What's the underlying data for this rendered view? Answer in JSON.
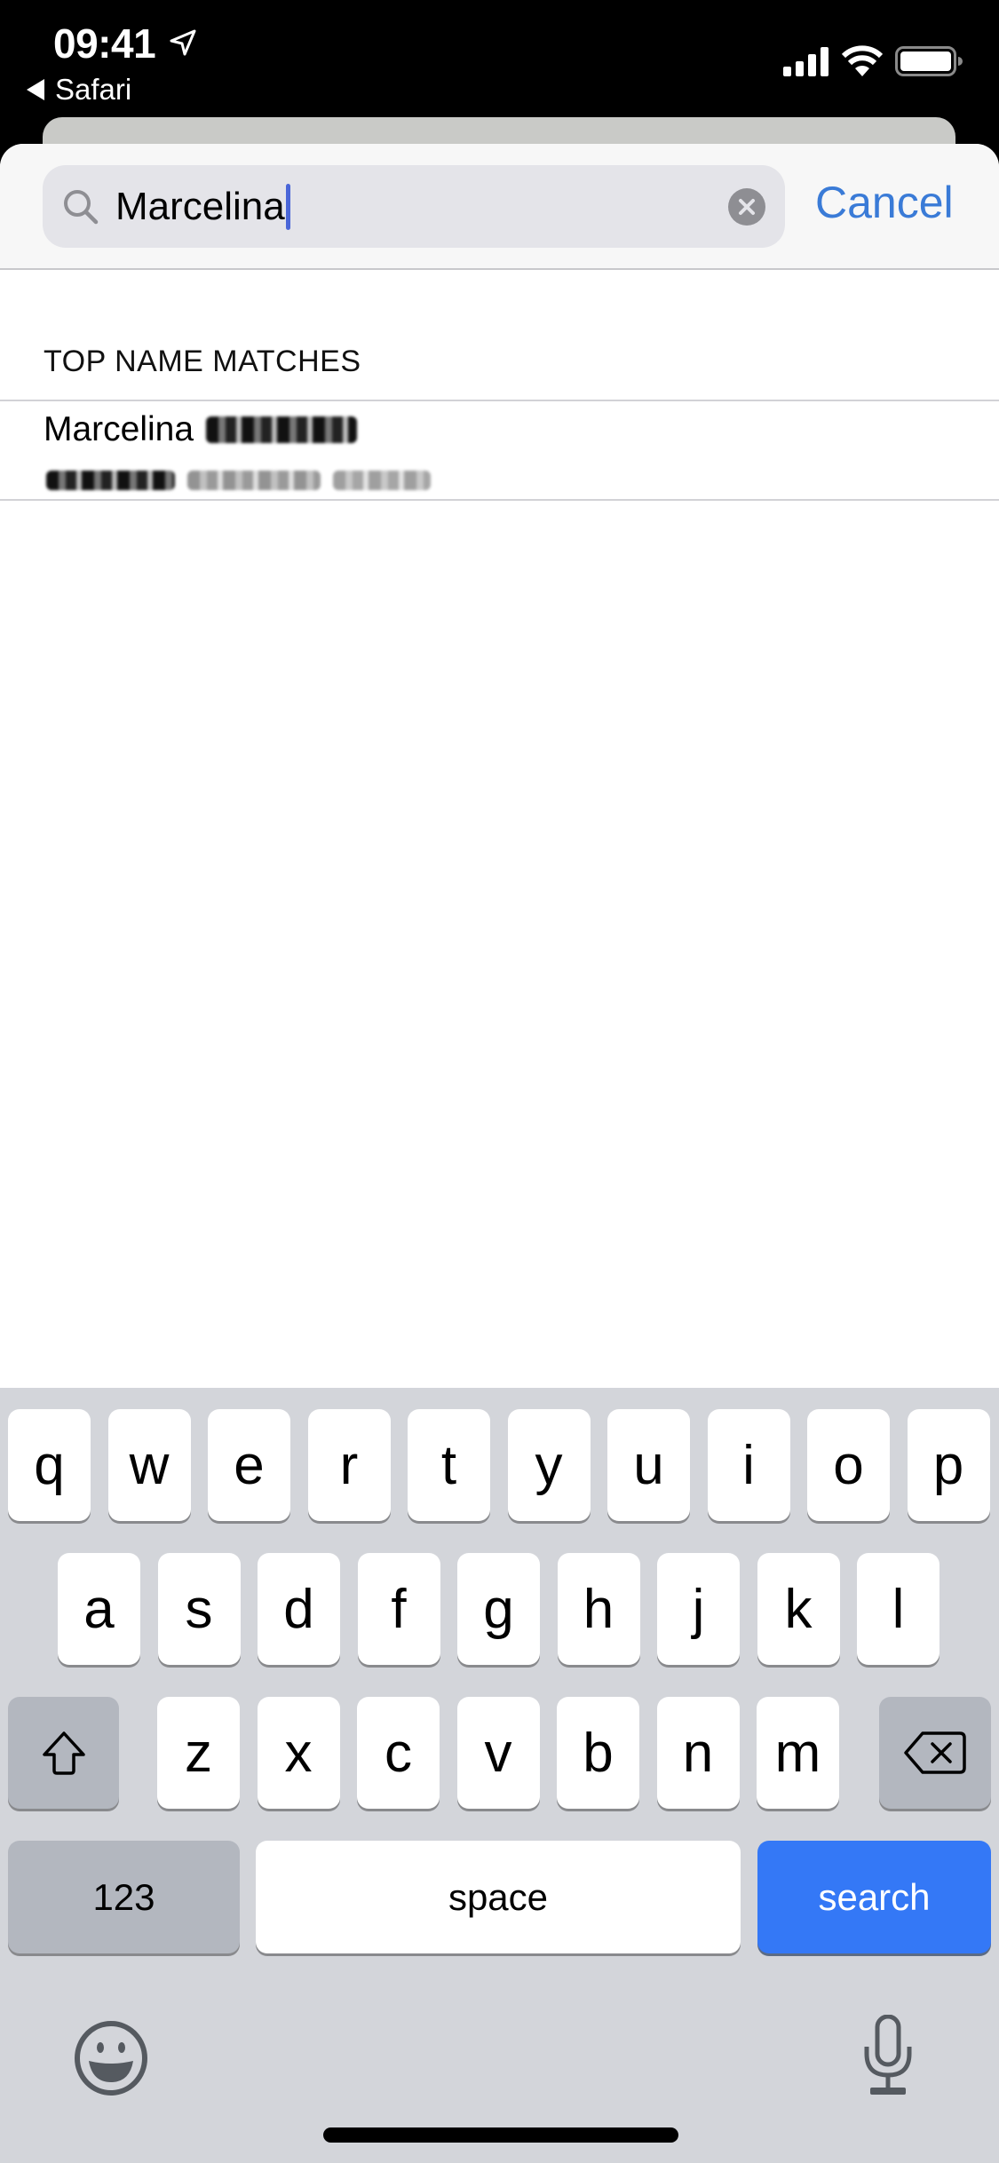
{
  "status_bar": {
    "time": "09:41",
    "location_icon": "location-arrow-icon",
    "back_app_label": "Safari",
    "icons": [
      "signal-bars-icon",
      "wifi-icon",
      "battery-full-icon"
    ]
  },
  "search": {
    "value": "Marcelina",
    "placeholder": "Search",
    "cancel_label": "Cancel"
  },
  "results": {
    "section_header": "TOP NAME MATCHES",
    "items": [
      {
        "name": "Marcelina",
        "name_redacted": true,
        "subtitle_redacted": true
      }
    ]
  },
  "keyboard": {
    "row1": [
      "q",
      "w",
      "e",
      "r",
      "t",
      "y",
      "u",
      "i",
      "o",
      "p"
    ],
    "row2": [
      "a",
      "s",
      "d",
      "f",
      "g",
      "h",
      "j",
      "k",
      "l"
    ],
    "row3": [
      "z",
      "x",
      "c",
      "v",
      "b",
      "n",
      "m"
    ],
    "numbers_label": "123",
    "space_label": "space",
    "return_label": "search",
    "return_color": "#3478f6"
  },
  "colors": {
    "accent": "#3a7bd7",
    "cursor": "#4a66d8",
    "keyboard_bg": "#d3d5da"
  }
}
